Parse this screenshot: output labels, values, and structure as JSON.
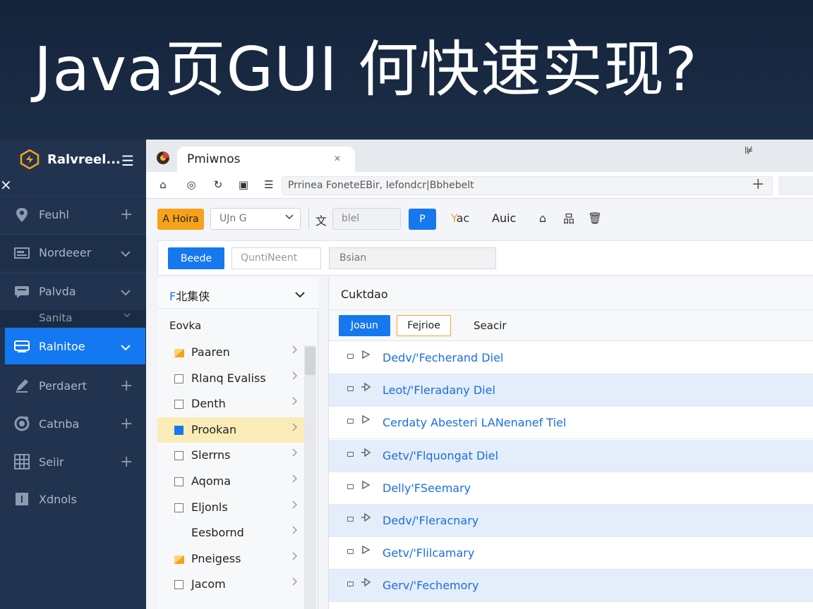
{
  "banner": {
    "title": "Java页GUI 何快速实现?"
  },
  "sidebar": {
    "brand": "Ralvreel...",
    "close": "×",
    "items": [
      {
        "label": "Feuhl",
        "icon": "location-pin-icon",
        "right": "+"
      },
      {
        "label": "Nordeeer",
        "icon": "folder-icon",
        "right": "⌄"
      },
      {
        "label": "Palvda",
        "icon": "chat-icon",
        "right": "⌄"
      },
      {
        "label": "Ralnitoe",
        "icon": "monitor-icon",
        "right": "⌄"
      },
      {
        "label": "Perdaert",
        "icon": "pen-icon",
        "right": "+"
      },
      {
        "label": "Catnba",
        "icon": "refresh-icon",
        "right": "+"
      },
      {
        "label": "Seiir",
        "icon": "grid-icon",
        "right": "+"
      },
      {
        "label": "Xdnols",
        "icon": "info-icon",
        "right": ""
      }
    ],
    "sub_item": {
      "label": "Sanita",
      "right": "⌄"
    }
  },
  "browser": {
    "tab_label": "Pmiwnos",
    "tab_close": "✕",
    "tab_right_icon": "⊯",
    "url": "Prrinea FoneteEBir, Iefondcr|Bbhebelt",
    "new_tab": "+"
  },
  "toolbar": {
    "orange_button": "A Hoira",
    "select_value": "UJn G",
    "text_icon": "文",
    "input_value": "blel",
    "blue_button": "P",
    "label_orange_prefix": "Y",
    "label_orange_rest": "ac",
    "label": "Auic"
  },
  "filterbar": {
    "button": "Beede",
    "input1": "QuntiNeent",
    "input2": "Bsian"
  },
  "left_panel": {
    "header_prefix": "F",
    "header_rest": "北集侠",
    "subheader": "Eovka",
    "rows": [
      {
        "label": "Paaren",
        "marker": "orange"
      },
      {
        "label": "Rlanq Evaliss",
        "marker": "box"
      },
      {
        "label": "Denth",
        "marker": "box"
      },
      {
        "label": "Prookan",
        "marker": "blue"
      },
      {
        "label": "Slerrns",
        "marker": "box"
      },
      {
        "label": "Aqoma",
        "marker": "box"
      },
      {
        "label": "Eljonls",
        "marker": "box"
      },
      {
        "label": "Eesbornd",
        "marker": "none"
      },
      {
        "label": "Pneigess",
        "marker": "orange"
      },
      {
        "label": "Jacom",
        "marker": "box"
      }
    ]
  },
  "right_panel": {
    "header": "Cuktdao",
    "tab1": "Joaun",
    "tab2": "Fejrioe",
    "tab3": "Seacir",
    "rows": [
      "Dedv/'Fecherand Diel",
      "Leot/'Fleradany Diel",
      "Cerdaty Abesteri LANenanef Tiel",
      "Getv/'Flquongat Diel",
      "Delly'FSeemary",
      "Dedv/'Fleracnary",
      "Getv/'Flilcamary",
      "Gerv/'Fechemory"
    ]
  }
}
